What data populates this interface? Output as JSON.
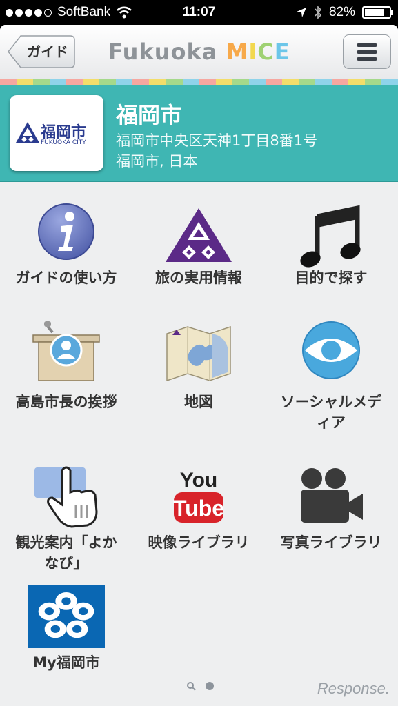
{
  "status": {
    "carrier": "SoftBank",
    "time": "11:07",
    "battery_text": "82%",
    "battery_level": 0.82
  },
  "nav": {
    "back_label": "ガイド",
    "brand_part1": "Fukuoka",
    "brand_part2": "MICE"
  },
  "brand_colors": [
    "#f7a94a",
    "#f2d84f",
    "#9fd173",
    "#6cc6e9"
  ],
  "stripe_colors": [
    "#f6a7a0",
    "#f3dd6a",
    "#a5d98b",
    "#8fd3ea"
  ],
  "header": {
    "logo_kanji": "福岡市",
    "logo_english": "FUKUOKA CITY",
    "title": "福岡市",
    "address_line1": "福岡市中央区天神1丁目8番1号",
    "address_line2": "福岡市, 日本",
    "bg_color": "#3fb6b3"
  },
  "tiles": [
    {
      "label": "ガイドの使い方",
      "icon": "info-icon"
    },
    {
      "label": "旅の実用情報",
      "icon": "fukuoka-emblem-icon"
    },
    {
      "label": "目的で探す",
      "icon": "music-note-icon"
    },
    {
      "label": "高島市長の挨拶",
      "icon": "podium-icon"
    },
    {
      "label": "地図",
      "icon": "map-icon"
    },
    {
      "label": "ソーシャルメディア",
      "icon": "eye-icon",
      "line1": "ソーシャルメデ",
      "line2": "ィア"
    },
    {
      "label": "観光案内「よかなび」",
      "icon": "touch-hand-icon",
      "line1": "観光案内「よか",
      "line2": "なび」"
    },
    {
      "label": "映像ライブラリ",
      "icon": "youtube-icon",
      "yt_top": "You",
      "yt_bottom": "Tube"
    },
    {
      "label": "写真ライブラリ",
      "icon": "video-camera-icon"
    },
    {
      "label": "My福岡市",
      "icon": "fukuoka-prefecture-flower-icon"
    }
  ],
  "watermark": "Response."
}
